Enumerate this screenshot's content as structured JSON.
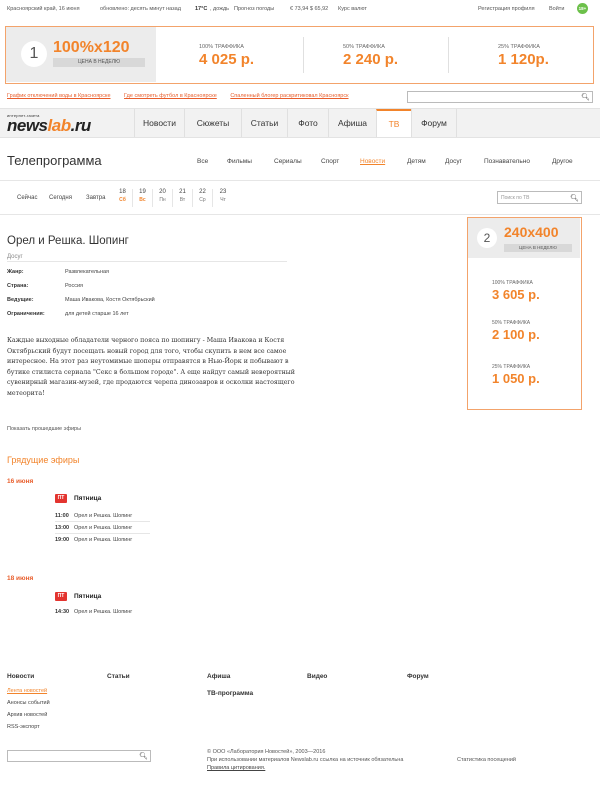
{
  "topbar": {
    "region": "Красноярский край, 16 июня",
    "updated": "обновлено: десять минут назад",
    "temp": "17°С",
    "weather": ", дождь",
    "forecast": "Прогноз погоды",
    "currency": "€ 73,94  $ 65,92",
    "currency_link": "Курс валют",
    "register": "Регистрация профиля",
    "login": "Войти",
    "age": "18+"
  },
  "ad_banner": {
    "num": "1",
    "size": "100%x120",
    "week": "ЦЕНА В НЕДЕЛЮ",
    "tiers": [
      {
        "label": "100% ТРАФФИКА",
        "price": "4 025 р."
      },
      {
        "label": "50% ТРАФФИКА",
        "price": "2 240 р."
      },
      {
        "label": "25% ТРАФФИКА",
        "price": "1 120р."
      }
    ]
  },
  "links": [
    "График отключений воды в Красноярске",
    "Где смотреть футбол в Красноярске",
    "Спаленный блогер раскритиковал Красноярск"
  ],
  "logo": {
    "small": "интернет-газета",
    "news": "news",
    "lab": "lab",
    "ru": ".ru"
  },
  "nav": [
    "Новости",
    "Сюжеты",
    "Статьи",
    "Фото",
    "Афиша",
    "ТВ",
    "Форум"
  ],
  "page": {
    "title": "Телепрограмма",
    "categories": [
      "Все",
      "Фильмы",
      "Сериалы",
      "Спорт",
      "Новости",
      "Детям",
      "Досуг",
      "Познавательно",
      "Другое"
    ]
  },
  "dates": {
    "words": [
      "Сейчас",
      "Сегодня",
      "Завтра"
    ],
    "days": [
      {
        "n": "18",
        "w": "Сб"
      },
      {
        "n": "19",
        "w": "Вс"
      },
      {
        "n": "20",
        "w": "Пн"
      },
      {
        "n": "21",
        "w": "Вт"
      },
      {
        "n": "22",
        "w": "Ср"
      },
      {
        "n": "23",
        "w": "Чт"
      }
    ],
    "search_placeholder": "Поиск по ТВ"
  },
  "program": {
    "title": "Орел и Решка. Шопинг",
    "genre": "Досуг",
    "props": [
      {
        "k": "Жанр:",
        "v": "Развлекательная"
      },
      {
        "k": "Страна:",
        "v": "Россия"
      },
      {
        "k": "Ведущие:",
        "v": "Маша Ивакова, Костя Октябрьский"
      },
      {
        "k": "Ограничения:",
        "v": "для детей старше 16 лет"
      }
    ],
    "description": "Каждые выходные обладатели черного пояса по шопингу - Маша Ивакова и Костя Октябрьский будут посещать новый город для того, чтобы скупить в нем все самое интересное. На этот раз неутомимые шоперы отправятся в Нью-Йорк и побывают в бутике стилиста сериала \"Секс в большом городе\". А еще найдут самый невероятный сувенирный магазин-музей, где продаются черепа динозавров и осколки настоящего метеорита!",
    "show_past": "Показать прошедшие эфиры"
  },
  "side_ad": {
    "num": "2",
    "size": "240x400",
    "week": "ЦЕНА В НЕДЕЛЮ",
    "tiers": [
      {
        "label": "100% ТРАФФИКА",
        "price": "3 605 р."
      },
      {
        "label": "50% ТРАФФИКА",
        "price": "2 100 р."
      },
      {
        "label": "25% ТРАФФИКА",
        "price": "1 050 р."
      }
    ]
  },
  "upcoming": {
    "title": "Грядущие эфиры",
    "groups": [
      {
        "date": "16 июня",
        "channel_logo": "ПТ",
        "channel": "Пятница",
        "items": [
          {
            "t": "11:00",
            "n": "Орел и Решка. Шопинг"
          },
          {
            "t": "13:00",
            "n": "Орел и Решка. Шопинг"
          },
          {
            "t": "19:00",
            "n": "Орел и Решка. Шопинг"
          }
        ]
      },
      {
        "date": "18 июня",
        "channel_logo": "ПТ",
        "channel": "Пятница",
        "items": [
          {
            "t": "14:30",
            "n": "Орел и Решка. Шопинг"
          }
        ]
      }
    ]
  },
  "footer": {
    "heads": [
      "Новости",
      "Статьи",
      "Афиша",
      "Видео",
      "Форум"
    ],
    "tv": "ТВ-программа",
    "news_links": [
      "Лента новостей",
      "Анонсы событий",
      "Архив новостей",
      "RSS-экспорт"
    ],
    "copyright": "© ООО «Лаборатория Новостей», 2003—2016",
    "notice": "При использовании материалов Newslab.ru ссылка на источник обязательна",
    "rules": "Правила цитирования.",
    "stats": "Статистика посещений"
  }
}
